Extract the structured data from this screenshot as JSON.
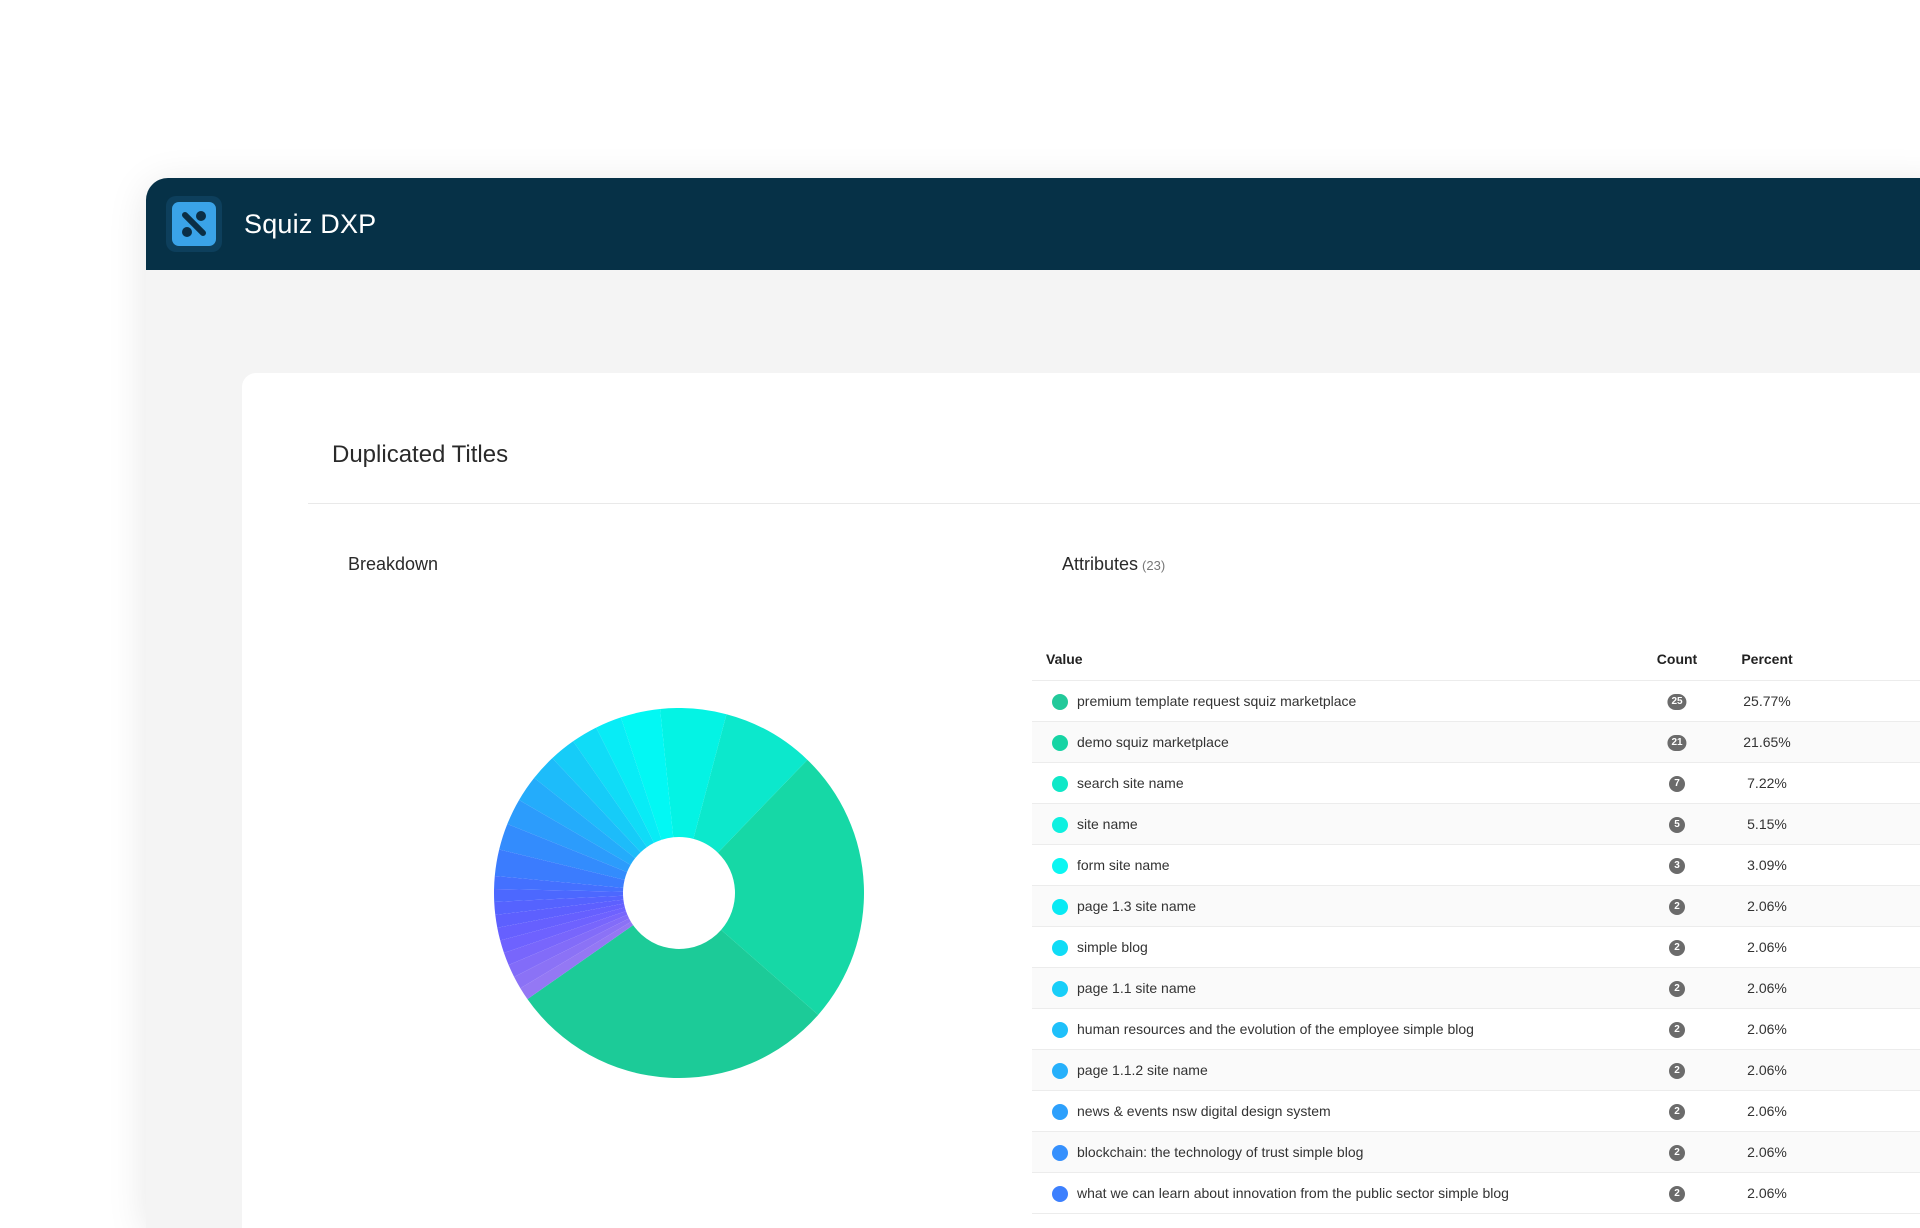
{
  "app": {
    "title": "Squiz DXP"
  },
  "card": {
    "title": "Duplicated Titles"
  },
  "breakdown": {
    "label": "Breakdown"
  },
  "attributes": {
    "label": "Attributes",
    "count": "(23)"
  },
  "table": {
    "headers": {
      "value": "Value",
      "count": "Count",
      "percent": "Percent"
    },
    "rows": [
      {
        "value": "premium template request squiz marketplace",
        "count": "25",
        "percent": "25.77%",
        "color": "#22c99a"
      },
      {
        "value": "demo squiz marketplace",
        "count": "21",
        "percent": "21.65%",
        "color": "#16d4a4"
      },
      {
        "value": "search site name",
        "count": "7",
        "percent": "7.22%",
        "color": "#0fe8c8"
      },
      {
        "value": "site name",
        "count": "5",
        "percent": "5.15%",
        "color": "#0ef0e0"
      },
      {
        "value": "form site name",
        "count": "3",
        "percent": "3.09%",
        "color": "#0af6f2"
      },
      {
        "value": "page 1.3 site name",
        "count": "2",
        "percent": "2.06%",
        "color": "#08eaf4"
      },
      {
        "value": "simple blog",
        "count": "2",
        "percent": "2.06%",
        "color": "#10dcf6"
      },
      {
        "value": "page 1.1 site name",
        "count": "2",
        "percent": "2.06%",
        "color": "#18cef8"
      },
      {
        "value": "human resources and the evolution of the employee simple blog",
        "count": "2",
        "percent": "2.06%",
        "color": "#1fc0fa"
      },
      {
        "value": "page 1.1.2 site name",
        "count": "2",
        "percent": "2.06%",
        "color": "#26b0fb"
      },
      {
        "value": "news & events nsw digital design system",
        "count": "2",
        "percent": "2.06%",
        "color": "#2da0fc"
      },
      {
        "value": "blockchain: the technology of trust simple blog",
        "count": "2",
        "percent": "2.06%",
        "color": "#3590fd"
      },
      {
        "value": "what we can learn about innovation from the public sector simple blog",
        "count": "2",
        "percent": "2.06%",
        "color": "#3d80fe"
      }
    ]
  },
  "chart_data": {
    "type": "pie",
    "hole": true,
    "labels": [
      "premium template request squiz marketplace",
      "demo squiz marketplace",
      "search site name",
      "site name",
      "form site name",
      "page 1.3 site name",
      "simple blog",
      "page 1.1 site name",
      "human resources and the evolution of the employee simple blog",
      "page 1.1.2 site name",
      "news & events nsw digital design system",
      "blockchain: the technology of trust simple blog",
      "what we can learn about innovation from the public sector simple blog"
    ],
    "values": [
      25.77,
      21.65,
      7.22,
      5.15,
      3.09,
      2.06,
      2.06,
      2.06,
      2.06,
      2.06,
      2.06,
      2.06,
      2.06
    ],
    "colors": [
      "#1ccb98",
      "#16d8a6",
      "#0ce8cc",
      "#04f3e4",
      "#02f8f4",
      "#08ecf6",
      "#10dcf7",
      "#16ccf8",
      "#1dbcfa",
      "#24acfb",
      "#2c9cfc",
      "#338cfd",
      "#3b7cfe"
    ],
    "remaining_colors": [
      "#4470ff",
      "#4c68ff",
      "#5563ff",
      "#5d60ff",
      "#6660ff",
      "#6e62ff",
      "#7866fc",
      "#826cf9",
      "#8b72f6",
      "#9478f4"
    ],
    "remaining_value_each": 1.0
  }
}
